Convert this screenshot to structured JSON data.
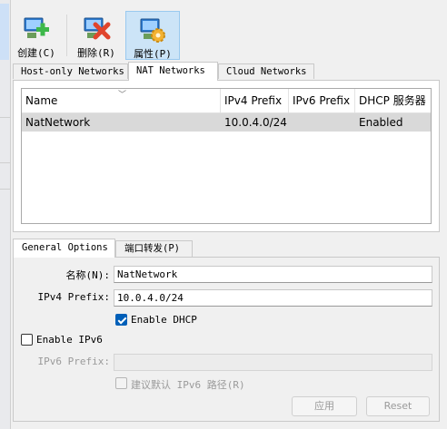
{
  "toolbar": {
    "create": "创建(C)",
    "remove": "删除(R)",
    "properties": "属性(P)"
  },
  "tabs": [
    "Host-only Networks",
    "NAT Networks",
    "Cloud Networks"
  ],
  "table": {
    "columns": [
      "Name",
      "IPv4 Prefix",
      "IPv6 Prefix",
      "DHCP 服务器"
    ],
    "rows": [
      {
        "name": "NatNetwork",
        "ipv4": "10.0.4.0/24",
        "ipv6": "",
        "dhcp": "Enabled"
      }
    ]
  },
  "subtabs": [
    "General Options",
    "端口转发(P)"
  ],
  "form": {
    "name_label": "名称(N):",
    "name_value": "NatNetwork",
    "ipv4_label": "IPv4 Prefix:",
    "ipv4_value": "10.0.4.0/24",
    "enable_dhcp": "Enable DHCP",
    "enable_ipv6": "Enable IPv6",
    "ipv6_label": "IPv6 Prefix:",
    "ipv6_value": "",
    "default_route": "建议默认 IPv6 路径(R)"
  },
  "buttons": {
    "apply": "应用",
    "reset": "Reset"
  }
}
